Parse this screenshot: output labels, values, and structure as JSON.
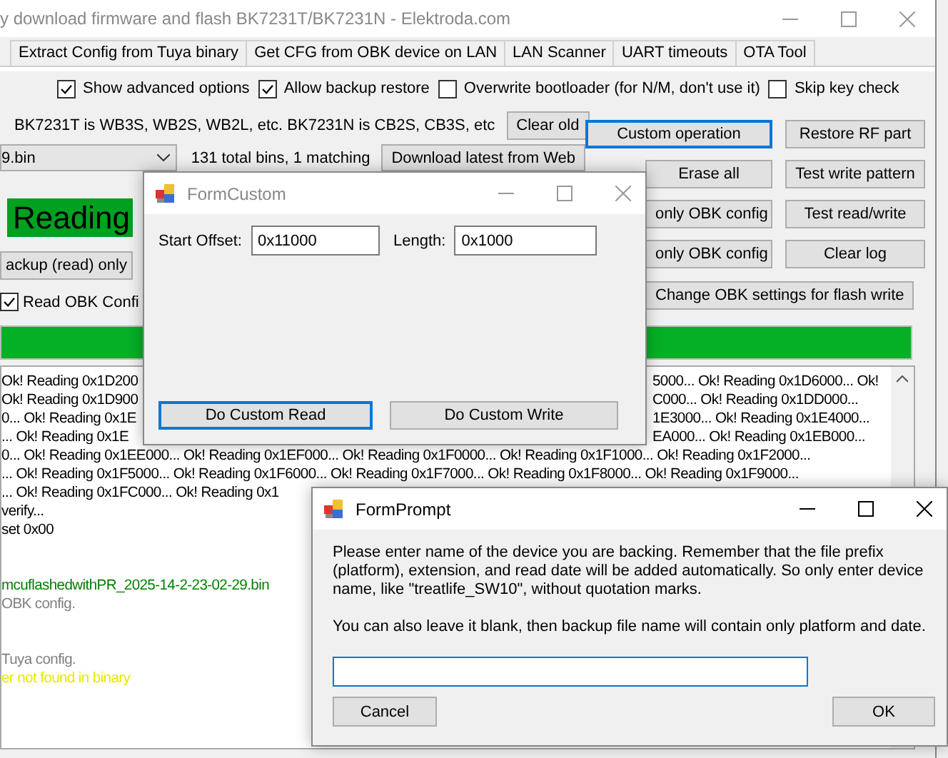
{
  "main_window": {
    "title": "y download firmware and flash BK7231T/BK7231N  - Elektroda.com",
    "tabs": [
      {
        "label": "Extract Config from Tuya binary",
        "selected": false
      },
      {
        "label": "Get CFG from OBK device on LAN",
        "selected": false
      },
      {
        "label": "LAN Scanner",
        "selected": false
      },
      {
        "label": "UART timeouts",
        "selected": false
      },
      {
        "label": "OTA Tool",
        "selected": false
      }
    ],
    "options": [
      {
        "label": "Show advanced options",
        "checked": true
      },
      {
        "label": "Allow backup restore",
        "checked": true
      },
      {
        "label": "Overwrite bootloader (for N/M, don't use it)",
        "checked": false
      },
      {
        "label": "Skip key check",
        "checked": false
      }
    ],
    "info_text": "BK7231T is WB3S, WB2S, WB2L, etc. BK7231N is CB2S, CB3S, etc",
    "clear_old_button": "Clear old",
    "firmware_select": "9.bin",
    "bins_count": "131 total bins, 1 matching",
    "download_button": "Download latest from Web",
    "status": "Reading",
    "backup_button": "ackup (read) only",
    "read_obk_config": {
      "label": "Read OBK Confi",
      "checked": true
    },
    "actions_left": [
      {
        "label": "Custom operation",
        "focused": true
      },
      {
        "label": "Erase all",
        "focused": false
      },
      {
        "label": "only OBK config",
        "focused": false
      },
      {
        "label": "only OBK config",
        "focused": false
      }
    ],
    "actions_right": [
      {
        "label": "Restore RF part"
      },
      {
        "label": "Test write pattern"
      },
      {
        "label": "Test read/write"
      },
      {
        "label": "Clear log"
      }
    ],
    "settings_button": "Change OBK settings for flash write",
    "progress": {
      "level": 1
    },
    "log": [
      {
        "text": "Ok! Reading 0x1D200",
        "text_right": "5000... Ok! Reading 0x1D6000... Ok!",
        "color": "#000000"
      },
      {
        "text": "Ok! Reading 0x1D900",
        "text_right": "C000... Ok! Reading 0x1DD000...",
        "color": "#000000"
      },
      {
        "text": "0... Ok! Reading 0x1E",
        "text_right": "1E3000... Ok! Reading 0x1E4000...",
        "color": "#000000"
      },
      {
        "text": "... Ok! Reading 0x1E",
        "text_right": "EA000... Ok! Reading 0x1EB000...",
        "color": "#000000"
      },
      {
        "text": "0... Ok! Reading 0x1EE000... Ok! Reading 0x1EF000... Ok! Reading 0x1F0000... Ok! Reading 0x1F1000... Ok! Reading 0x1F2000...",
        "color": "#000000"
      },
      {
        "text": "... Ok! Reading 0x1F5000... Ok! Reading 0x1F6000... Ok! Reading 0x1F7000... Ok! Reading 0x1F8000... Ok! Reading 0x1F9000...",
        "color": "#000000"
      },
      {
        "text": "... Ok! Reading 0x1FC000... Ok! Reading 0x1",
        "color": "#000000"
      },
      {
        "text": "verify...",
        "color": "#000000"
      },
      {
        "text": "set 0x00",
        "color": "#000000"
      },
      {
        "text": "mcuflashedwithPR_2025-14-2-23-02-29.bin",
        "color": "#008000",
        "gap": true
      },
      {
        "text": "OBK config.",
        "color": "#808080"
      },
      {
        "text": "Tuya config.",
        "color": "#808080",
        "gap": true
      },
      {
        "text": "er not found in binary",
        "color": "#e8e800"
      }
    ]
  },
  "custom_dialog": {
    "title": "FormCustom",
    "active": false,
    "start_label": "Start Offset:",
    "start_value": "0x11000",
    "length_label": "Length:",
    "length_value": "0x1000",
    "read_button": "Do Custom Read",
    "write_button": "Do Custom Write"
  },
  "prompt_dialog": {
    "title": "FormPrompt",
    "active": true,
    "message": "Please enter name of the device you are backing. Remember that the file prefix (platform), extension, and read date will be added automatically. So only enter device name, like \"treatlife_SW10\", without quotation marks.",
    "message_2": "You can also leave it blank, then backup file name will contain only platform and date.",
    "cancel_button": "Cancel",
    "ok_button": "OK"
  }
}
